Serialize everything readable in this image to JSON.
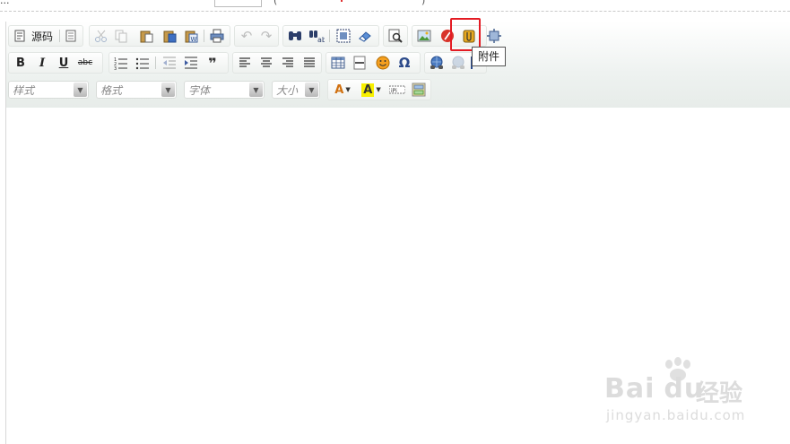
{
  "topbar": {
    "text": "...",
    "paren_open": "(",
    "paren_close": ")"
  },
  "toolbar": {
    "source_label": "源码",
    "icons": {
      "source": "document-icon",
      "template": "template-icon",
      "cut": "scissors-icon",
      "copy": "copy-icon",
      "paste": "paste-icon",
      "paste_text": "paste-text-icon",
      "paste_word": "paste-word-icon",
      "print": "printer-icon",
      "undo": "undo-icon",
      "redo": "redo-icon",
      "find": "binoculars-icon",
      "replace": "replace-icon",
      "select_all": "select-all-icon",
      "remove_format": "eraser-icon",
      "preview": "preview-icon",
      "image": "image-icon",
      "flash": "flash-icon",
      "attachment": "attachment-icon",
      "maximize": "maximize-icon"
    },
    "format_buttons": {
      "bold": "B",
      "italic": "I",
      "underline": "U",
      "strike": "abc",
      "blockquote": "❞",
      "special_char": "Ω"
    },
    "combos": {
      "style": "样式",
      "format": "格式",
      "font": "字体",
      "size": "大小"
    },
    "text_color_glyph": "A",
    "bg_color_glyph": "A",
    "tooltip": "附件"
  },
  "watermark": {
    "logo": "Bai",
    "logo2": "du",
    "cn": "经验",
    "url": "jingyan.baidu.com"
  },
  "colors": {
    "highlight": "#e31b23",
    "toolbar_bg": "#eef2f0"
  }
}
